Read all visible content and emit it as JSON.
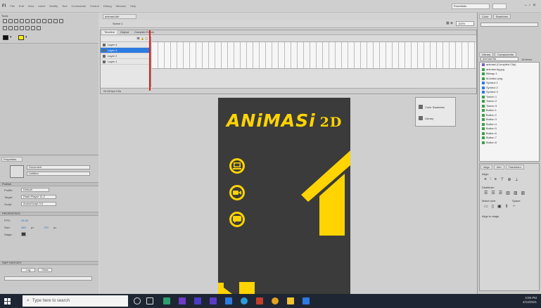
{
  "app": {
    "logo": "Fl",
    "menu": [
      "File",
      "Edit",
      "View",
      "Insert",
      "Modify",
      "Text",
      "Commands",
      "Control",
      "Debug",
      "Window",
      "Help"
    ],
    "workspace": "Essentials"
  },
  "document": {
    "tab": "animasi.fla*",
    "scene": "Scene 1",
    "zoom": "100%"
  },
  "tools": {
    "title": "Tools"
  },
  "timeline": {
    "tabs": [
      "Timeline",
      "Output",
      "Compiler Errors"
    ],
    "layers": [
      "Layer 4",
      "Layer 3",
      "Layer 2",
      "Layer 1"
    ],
    "footer": "24.00 fps  0.0s"
  },
  "stage": {
    "title_main": "ANiMASi",
    "title_suffix": "2D",
    "buttons": [
      "computer",
      "video",
      "chat"
    ]
  },
  "float_panel": {
    "items": [
      "Color Swatches",
      "Library"
    ]
  },
  "properties": {
    "tab": "Properties",
    "doc_name": "Document",
    "doc_value": "Untitled",
    "publish_label": "Publish",
    "profile_label": "Profile:",
    "profile_value": "Default",
    "target_label": "Target:",
    "target_value": "Flash Player 11.2",
    "script_label": "Script:",
    "script_value": "ActionScript 3.0",
    "section_properties": "PROPERTIES",
    "fps_label": "FPS:",
    "fps_value": "24.00",
    "size_label": "Size:",
    "size_w": "480",
    "size_h": "720",
    "px_unit": "px",
    "stage_label": "Stage:",
    "section_swf": "SWF HISTORY",
    "log_label": "Log",
    "clear_label": "Clear"
  },
  "right_panel": {
    "tabs": [
      "Color",
      "Swatches"
    ],
    "library_tabs": [
      "Library",
      "Components"
    ],
    "library_dropdown": "animasi.fla",
    "library_count": "18 items",
    "library_items": [
      "animasi (Compiled Clip)",
      "animasi bg.jpg",
      "Bitmap 1",
      "ld-button.png",
      "Symbol 1",
      "Symbol 2",
      "Symbol 3",
      "Tween 1",
      "Tween 2",
      "Tween 3",
      "Button 1",
      "Button 2",
      "Button 3",
      "Button 4",
      "Button 5",
      "Button 6",
      "Button 7",
      "Button 8"
    ],
    "align_tabs": [
      "Align",
      "Info",
      "Transform"
    ],
    "align_label": "Align:",
    "distribute_label": "Distribute:",
    "match_label": "Match size:",
    "space_label": "Space:",
    "to_stage": "Align to stage"
  },
  "taskbar": {
    "search_placeholder": "Type here to search",
    "time": "3:05 PM",
    "date": "4/13/2021"
  },
  "colors": {
    "accent_yellow": "#ffd400",
    "stage_bg": "#3b3b3b",
    "selection_blue": "#2b7be0",
    "playhead_red": "#e21c1c"
  }
}
